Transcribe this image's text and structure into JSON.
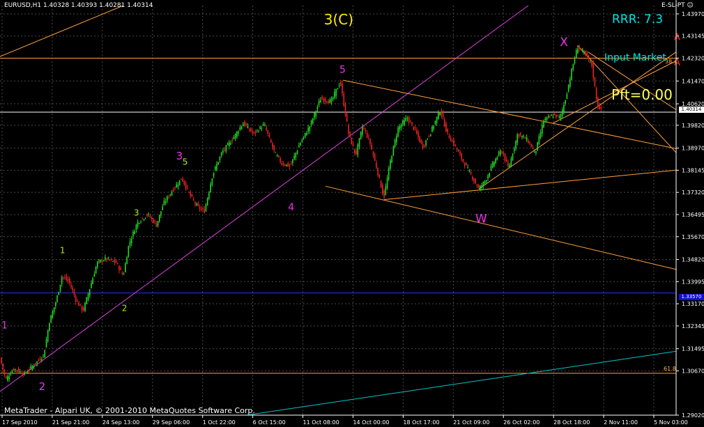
{
  "window": {
    "symbol_line": "EURUSD,H1  1.40328 1.40393 1.40281 1.40314",
    "indicator_tag": "E-SL-PT ☺",
    "copyright": "MetaTrader - Alpari UK, © 2001-2010 MetaQuotes Software Corp."
  },
  "overlay": {
    "rrr": "RRR: 7.3",
    "input_market": "Input Market",
    "pft": "Pft=0.00",
    "current_price_tag": "1.40314",
    "hline_tag": "1.33570",
    "fib_label": "61.8",
    "fib_label_top": "38.4"
  },
  "colors": {
    "background": "#000000",
    "grid": "#4a4a4a",
    "bull_candle": "#22dd22",
    "bear_candle": "#ee2222",
    "trendline": "#ffa040",
    "channel": "#dd44dd",
    "support_line": "#2233ff",
    "teal_line": "#00c8c8",
    "wave_magenta": "#ee33ee",
    "wave_green": "#aaee22",
    "wave_yellow": "#ffee00",
    "marker_red": "#ff2222"
  },
  "chart_data": {
    "type": "candlestick",
    "title": "EURUSD,H1",
    "ylim": [
      1.2902,
      1.4428
    ],
    "y_ticks": [
      "1.43970",
      "1.43145",
      "1.42320",
      "1.41470",
      "1.40620",
      "1.39820",
      "1.38970",
      "1.38145",
      "1.37320",
      "1.36495",
      "1.35670",
      "1.34820",
      "1.33995",
      "1.33170",
      "1.32345",
      "1.31495",
      "1.30670",
      "1.29020"
    ],
    "x_ticks": [
      "17 Sep 2010",
      "21 Sep 21:00",
      "24 Sep 13:00",
      "29 Sep 06:00",
      "1 Oct 22:00",
      "6 Oct 15:00",
      "11 Oct 08:00",
      "14 Oct 00:00",
      "18 Oct 17:00",
      "21 Oct 09:00",
      "26 Oct 02:00",
      "28 Oct 18:00",
      "2 Nov 11:00",
      "5 Nov 03:00"
    ],
    "x_range": [
      0,
      960
    ],
    "price_path": [
      [
        0,
        1.3115
      ],
      [
        8,
        1.3035
      ],
      [
        20,
        1.3075
      ],
      [
        35,
        1.3055
      ],
      [
        50,
        1.3095
      ],
      [
        62,
        1.3125
      ],
      [
        70,
        1.325
      ],
      [
        80,
        1.333
      ],
      [
        88,
        1.342
      ],
      [
        98,
        1.34
      ],
      [
        108,
        1.333
      ],
      [
        118,
        1.329
      ],
      [
        128,
        1.338
      ],
      [
        138,
        1.347
      ],
      [
        150,
        1.3485
      ],
      [
        165,
        1.347
      ],
      [
        175,
        1.342
      ],
      [
        183,
        1.354
      ],
      [
        195,
        1.362
      ],
      [
        210,
        1.365
      ],
      [
        222,
        1.361
      ],
      [
        232,
        1.369
      ],
      [
        245,
        1.374
      ],
      [
        258,
        1.3785
      ],
      [
        270,
        1.372
      ],
      [
        280,
        1.368
      ],
      [
        290,
        1.366
      ],
      [
        302,
        1.38
      ],
      [
        315,
        1.388
      ],
      [
        330,
        1.393
      ],
      [
        345,
        1.399
      ],
      [
        360,
        1.395
      ],
      [
        375,
        1.3985
      ],
      [
        390,
        1.388
      ],
      [
        400,
        1.384
      ],
      [
        412,
        1.383
      ],
      [
        425,
        1.391
      ],
      [
        440,
        1.398
      ],
      [
        455,
        1.408
      ],
      [
        470,
        1.407
      ],
      [
        483,
        1.4145
      ],
      [
        495,
        1.395
      ],
      [
        505,
        1.387
      ],
      [
        515,
        1.398
      ],
      [
        525,
        1.392
      ],
      [
        535,
        1.382
      ],
      [
        545,
        1.3712
      ],
      [
        555,
        1.386
      ],
      [
        565,
        1.397
      ],
      [
        578,
        1.401
      ],
      [
        590,
        1.396
      ],
      [
        600,
        1.39
      ],
      [
        612,
        1.396
      ],
      [
        625,
        1.404
      ],
      [
        635,
        1.395
      ],
      [
        645,
        1.391
      ],
      [
        655,
        1.386
      ],
      [
        668,
        1.38
      ],
      [
        680,
        1.3745
      ],
      [
        690,
        1.378
      ],
      [
        700,
        1.384
      ],
      [
        712,
        1.389
      ],
      [
        722,
        1.382
      ],
      [
        735,
        1.395
      ],
      [
        748,
        1.393
      ],
      [
        760,
        1.388
      ],
      [
        772,
        1.4
      ],
      [
        785,
        1.402
      ],
      [
        795,
        1.401
      ],
      [
        802,
        1.407
      ],
      [
        812,
        1.419
      ],
      [
        820,
        1.4275
      ],
      [
        830,
        1.425
      ],
      [
        840,
        1.421
      ],
      [
        848,
        1.406
      ],
      [
        855,
        1.4031
      ]
    ],
    "horizontal_lines": [
      {
        "price": 1.4232,
        "color": "#ffa040",
        "label": "38.4"
      },
      {
        "price": 1.4031,
        "color": "#ffffff"
      },
      {
        "price": 1.3357,
        "color": "#2233ff"
      },
      {
        "price": 1.3058,
        "color": "#ffa040",
        "label": "61.8"
      }
    ],
    "trendlines": [
      {
        "from": [
          0,
          1.4238
        ],
        "to": [
          175,
          1.4428
        ],
        "color": "#ffa040"
      },
      {
        "from": [
          0,
          1.299
        ],
        "to": [
          750,
          1.4428
        ],
        "color": "#dd44dd"
      },
      {
        "from": [
          487,
          1.415
        ],
        "to": [
          960,
          1.3895
        ],
        "color": "#ffa040"
      },
      {
        "from": [
          462,
          1.3755
        ],
        "to": [
          960,
          1.3445
        ],
        "color": "#ffa040"
      },
      {
        "from": [
          545,
          1.3705
        ],
        "to": [
          960,
          1.3815
        ],
        "color": "#ffa040"
      },
      {
        "from": [
          680,
          1.3745
        ],
        "to": [
          960,
          1.4255
        ],
        "color": "#ffa040"
      },
      {
        "from": [
          785,
          1.399
        ],
        "to": [
          960,
          1.4222
        ],
        "color": "#ffa040"
      },
      {
        "from": [
          820,
          1.428
        ],
        "to": [
          960,
          1.388
        ],
        "color": "#ffa040"
      },
      {
        "from": [
          835,
          1.4255
        ],
        "to": [
          960,
          1.404
        ],
        "color": "#ffa040"
      },
      {
        "from": [
          350,
          1.2902
        ],
        "to": [
          960,
          1.314
        ],
        "color": "#00c8c8"
      }
    ],
    "annotations": [
      {
        "text": "3(C)",
        "x": 460,
        "price": 1.4358,
        "color": "#ffee00",
        "size": 20
      },
      {
        "text": "X",
        "x": 795,
        "price": 1.4278,
        "color": "#ee33ee",
        "size": 17
      },
      {
        "text": "5",
        "x": 482,
        "price": 1.4178,
        "color": "#ee33ee",
        "size": 14
      },
      {
        "text": "3",
        "x": 250,
        "price": 1.3855,
        "color": "#ee33ee",
        "size": 15
      },
      {
        "text": "5",
        "x": 259,
        "price": 1.3835,
        "color": "#aaee22",
        "size": 12
      },
      {
        "text": "4",
        "x": 409,
        "price": 1.3665,
        "color": "#ee33ee",
        "size": 14
      },
      {
        "text": "W",
        "x": 675,
        "price": 1.362,
        "color": "#ee33ee",
        "size": 17
      },
      {
        "text": "3",
        "x": 190,
        "price": 1.3645,
        "color": "#aaee22",
        "size": 12
      },
      {
        "text": "1",
        "x": 85,
        "price": 1.3505,
        "color": "#aaee22",
        "size": 12
      },
      {
        "text": "2",
        "x": 173,
        "price": 1.329,
        "color": "#aaee22",
        "size": 12
      },
      {
        "text": "1",
        "x": 2,
        "price": 1.3225,
        "color": "#ee33ee",
        "size": 14
      },
      {
        "text": "2",
        "x": 55,
        "price": 1.2995,
        "color": "#ee33ee",
        "size": 15
      },
      {
        "text": "A",
        "x": 957,
        "price": 1.43,
        "color": "#ff2222",
        "size": 13
      },
      {
        "text": "A",
        "x": 957,
        "price": 1.4205,
        "color": "#ff2222",
        "size": 13
      }
    ]
  }
}
